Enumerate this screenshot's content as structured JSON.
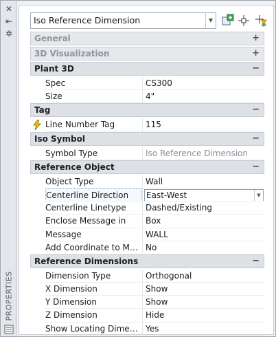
{
  "palette": {
    "title": "PROPERTIES",
    "object_type": "Iso Reference Dimension"
  },
  "categories": [
    {
      "name": "General",
      "collapsed": true,
      "rows": []
    },
    {
      "name": "3D Visualization",
      "collapsed": true,
      "rows": []
    },
    {
      "name": "Plant 3D",
      "collapsed": false,
      "rows": [
        {
          "label": "Spec",
          "value": "CS300"
        },
        {
          "label": "Size",
          "value": "4\""
        }
      ]
    },
    {
      "name": "Tag",
      "collapsed": false,
      "rows": [
        {
          "label": "Line Number Tag",
          "value": "115",
          "icon": "lightning-icon"
        }
      ]
    },
    {
      "name": "Iso Symbol",
      "collapsed": false,
      "rows": [
        {
          "label": "Symbol Type",
          "value": "Iso Reference Dimension",
          "readonly": true
        }
      ]
    },
    {
      "name": "Reference Object",
      "collapsed": false,
      "rows": [
        {
          "label": "Object Type",
          "value": "Wall"
        },
        {
          "label": "Centerline Direction",
          "value": "East-West",
          "active": true
        },
        {
          "label": "Centerline Linetype",
          "value": "Dashed/Existing"
        },
        {
          "label": "Enclose Message in",
          "value": "Box"
        },
        {
          "label": "Message",
          "value": "WALL"
        },
        {
          "label": "Add Coordinate to Mes...",
          "value": "No"
        }
      ]
    },
    {
      "name": "Reference Dimensions",
      "collapsed": false,
      "rows": [
        {
          "label": "Dimension Type",
          "value": "Orthogonal"
        },
        {
          "label": "X Dimension",
          "value": "Show"
        },
        {
          "label": "Y Dimension",
          "value": "Show"
        },
        {
          "label": "Z Dimension",
          "value": "Hide"
        },
        {
          "label": "Show Locating Dimensi...",
          "value": "Yes"
        }
      ]
    }
  ],
  "toggles": {
    "expanded": "−",
    "collapsed": "+"
  },
  "colors": {
    "category_bg": "#dde1e6",
    "readonly_text": "#8a8f95",
    "accent_green": "#3fa34d",
    "bolt": "#f2c200"
  }
}
